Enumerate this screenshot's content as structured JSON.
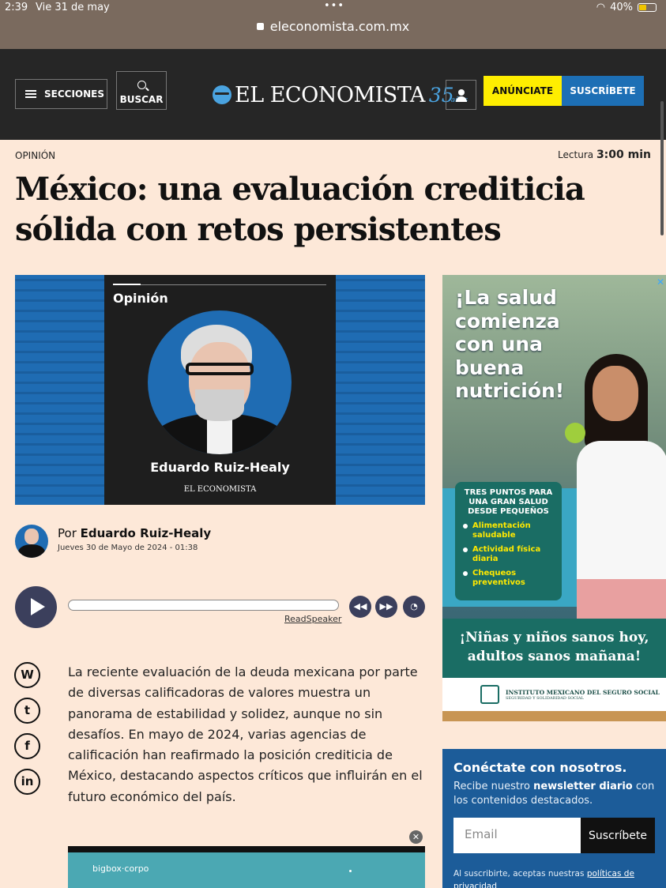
{
  "status_bar": {
    "time": "2:39",
    "date": "Vie 31 de may",
    "dots": "•••",
    "battery": "40%"
  },
  "browser": {
    "url": "eleconomista.com.mx"
  },
  "header": {
    "sections_label": "SECCIONES",
    "search_label": "BUSCAR",
    "logo_name": "EL ECONOMISTA",
    "logo_anniversary": "35",
    "logo_anos": "años",
    "advertise_label": "ANÚNCIATE",
    "subscribe_label": "SUSCRÍBETE"
  },
  "article": {
    "section": "OPINIÓN",
    "read_label": "Lectura",
    "read_time": "3:00 min",
    "title": "México: una evaluación crediticia sólida con retos persistentes",
    "hero": {
      "kicker": "Opinión",
      "author": "Eduardo Ruiz-Healy",
      "brand": "EL ECONOMISTA"
    },
    "by_prefix": "Por",
    "author": "Eduardo Ruiz-Healy",
    "date": "Jueves 30 de Mayo de 2024 - 01:38",
    "lead": "La reciente evaluación de la deuda mexicana por parte de diversas calificadoras de valores muestra un panorama de estabilidad y solidez, aunque no sin desafíos. En mayo de 2024, varias agencias de calificación han reafirmado la posición crediticia de México, destacando aspectos críticos que influirán en el futuro económico del país."
  },
  "audio": {
    "readspeaker_label": "ReadSpeaker",
    "progress": 0
  },
  "share": {
    "whatsapp": "W",
    "twitter": "t",
    "facebook": "f",
    "linkedin": "in"
  },
  "ads": {
    "side": {
      "close": "✕",
      "headline": "¡La salud comienza con una buena nutrición!",
      "tips_title": "TRES PUNTOS PARA UNA GRAN SALUD DESDE PEQUEÑOS",
      "tips": [
        "Alimentación saludable",
        "Actividad física diaria",
        "Chequeos preventivos"
      ],
      "slogan_1": "¡Niñas y niños sanos hoy,",
      "slogan_2": "adultos sanos mañana!",
      "institution": "INSTITUTO MEXICANO DEL SEGURO SOCIAL",
      "institution_sub": "SEGURIDAD Y SOLIDARIDAD SOCIAL"
    },
    "bottom": {
      "close": "✕",
      "label": "bigbox·corpo"
    }
  },
  "newsletter": {
    "heading": "Conéctate con nosotros.",
    "text_pre": "Recibe nuestro",
    "text_bold": "newsletter diario",
    "text_post": "con los contenidos destacados.",
    "email_placeholder": "Email",
    "subscribe_label": "Suscríbete",
    "legal_pre": "Al suscribirte, aceptas nuestras",
    "legal_link": "políticas de privacidad"
  },
  "colors": {
    "header_bg": "#262626",
    "accent_yellow": "#ffee00",
    "accent_blue": "#1d6fb5",
    "page_bg": "#fde8d8"
  }
}
